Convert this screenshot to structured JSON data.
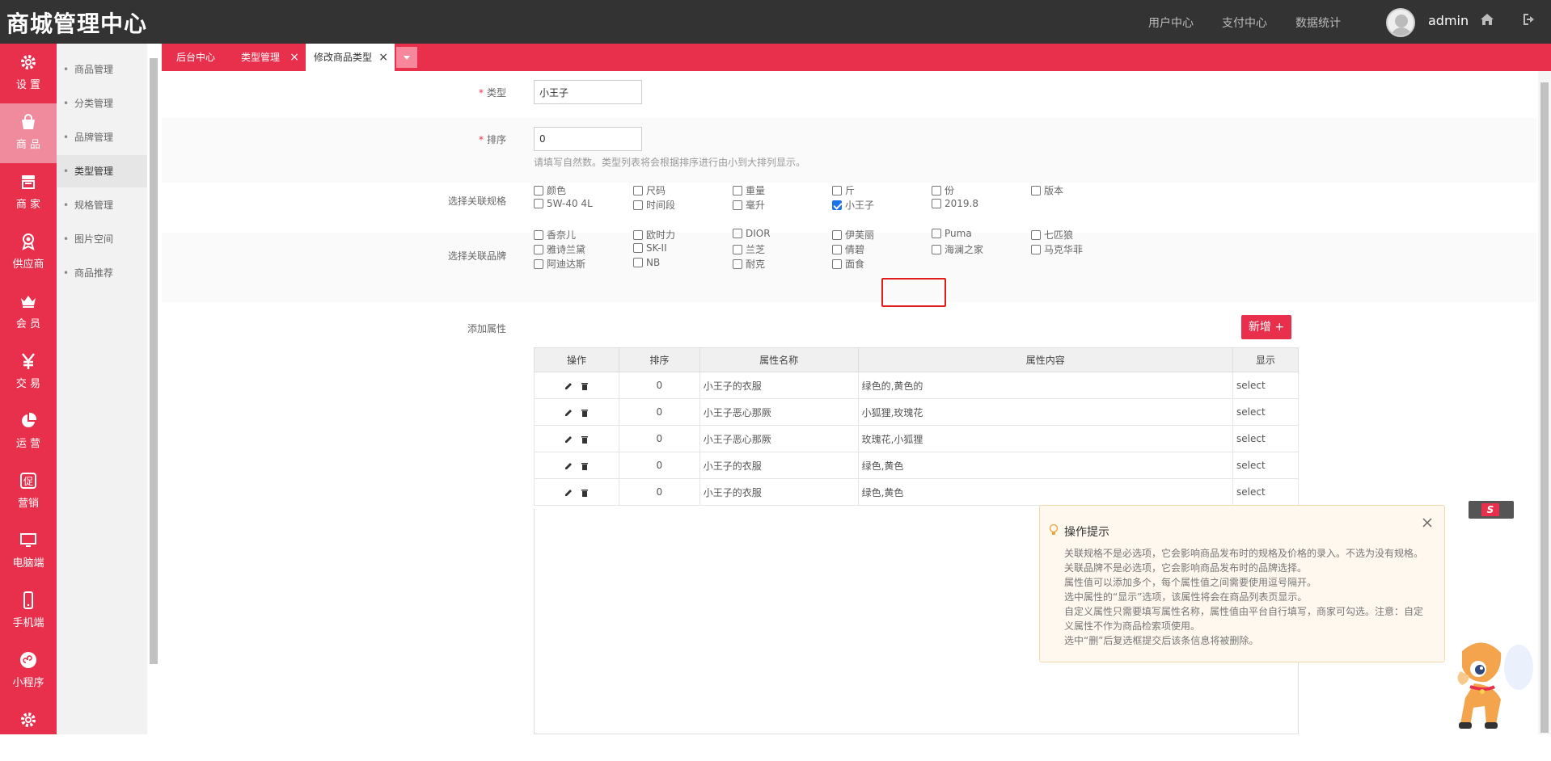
{
  "app": {
    "title": "商城管理中心",
    "top_nav": [
      "用户中心",
      "支付中心",
      "数据统计"
    ],
    "user": "admin"
  },
  "sidebar": [
    {
      "label": "设 置",
      "icon": "gear-icon"
    },
    {
      "label": "商 品",
      "icon": "shopping-bag-icon",
      "active": true
    },
    {
      "label": "商 家",
      "icon": "store-icon"
    },
    {
      "label": "供应商",
      "icon": "award-icon"
    },
    {
      "label": "会 员",
      "icon": "crown-icon"
    },
    {
      "label": "交 易",
      "icon": "yen-icon"
    },
    {
      "label": "运 营",
      "icon": "pie-chart-icon"
    },
    {
      "label": "营销",
      "icon": "promo-icon"
    },
    {
      "label": "电脑端",
      "icon": "monitor-icon"
    },
    {
      "label": "手机端",
      "icon": "mobile-icon"
    },
    {
      "label": "小程序",
      "icon": "miniprogram-icon"
    },
    {
      "label": "",
      "icon": "gear-icon"
    }
  ],
  "submenu": [
    {
      "label": "商品管理"
    },
    {
      "label": "分类管理"
    },
    {
      "label": "品牌管理"
    },
    {
      "label": "类型管理",
      "active": true
    },
    {
      "label": "规格管理"
    },
    {
      "label": "图片空间"
    },
    {
      "label": "商品推荐"
    }
  ],
  "tabs": [
    {
      "label": "后台中心"
    },
    {
      "label": "类型管理",
      "closable": true
    },
    {
      "label": "修改商品类型",
      "closable": true,
      "active": true
    }
  ],
  "form": {
    "type_label": "类型",
    "type_value": "小王子",
    "sort_label": "排序",
    "sort_value": "0",
    "sort_hint": "请填写自然数。类型列表将会根据排序进行由小到大排列显示。",
    "spec_label": "选择关联规格",
    "specs": [
      {
        "label": "颜色",
        "checked": false
      },
      {
        "label": "尺码",
        "checked": false
      },
      {
        "label": "重量",
        "checked": false
      },
      {
        "label": "斤",
        "checked": false
      },
      {
        "label": "份",
        "checked": false
      },
      {
        "label": "版本",
        "checked": false
      },
      {
        "label": "5W-40 4L",
        "checked": false
      },
      {
        "label": "时间段",
        "checked": false
      },
      {
        "label": "毫升",
        "checked": false
      },
      {
        "label": "小王子",
        "checked": true
      },
      {
        "label": "2019.8",
        "checked": false
      }
    ],
    "brand_label": "选择关联品牌",
    "brands": [
      {
        "label": "香奈儿",
        "checked": false
      },
      {
        "label": "欧时力",
        "checked": false
      },
      {
        "label": "DIOR",
        "checked": false
      },
      {
        "label": "伊芙丽",
        "checked": false
      },
      {
        "label": "Puma",
        "checked": false
      },
      {
        "label": "七匹狼",
        "checked": false
      },
      {
        "label": "雅诗兰黛",
        "checked": false
      },
      {
        "label": "SK-II",
        "checked": false
      },
      {
        "label": "兰芝",
        "checked": false
      },
      {
        "label": "倩碧",
        "checked": false
      },
      {
        "label": "海澜之家",
        "checked": false
      },
      {
        "label": "马克华菲",
        "checked": false
      },
      {
        "label": "阿迪达斯",
        "checked": false
      },
      {
        "label": "NB",
        "checked": false
      },
      {
        "label": "耐克",
        "checked": false
      },
      {
        "label": "面食",
        "checked": false
      }
    ],
    "attr_label": "添加属性",
    "add_button": "新增 +"
  },
  "attr_table": {
    "headers": [
      "操作",
      "排序",
      "属性名称",
      "属性内容",
      "显示"
    ],
    "rows": [
      {
        "sort": "0",
        "name": "小王子的衣服",
        "content": "绿色的,黄色的",
        "display": "select"
      },
      {
        "sort": "0",
        "name": "小王子恶心那厥",
        "content": "小狐狸,玫瑰花",
        "display": "select"
      },
      {
        "sort": "0",
        "name": "小王子恶心那厥",
        "content": "玫瑰花,小狐狸",
        "display": "select"
      },
      {
        "sort": "0",
        "name": "小王子的衣服",
        "content": "绿色,黄色",
        "display": "select"
      },
      {
        "sort": "0",
        "name": "小王子的衣服",
        "content": "绿色,黄色",
        "display": "select"
      }
    ]
  },
  "tip": {
    "title": "操作提示",
    "lines": [
      "关联规格不是必选项，它会影响商品发布时的规格及价格的录入。不选为没有规格。",
      "关联品牌不是必选项，它会影响商品发布时的品牌选择。",
      "属性值可以添加多个，每个属性值之间需要使用逗号隔开。",
      "选中属性的“显示”选项，该属性将会在商品列表页显示。",
      "自定义属性只需要填写属性名称，属性值由平台自行填写，商家可勾选。注意：自定义属性不作为商品检索项使用。",
      "选中“删”后复选框提交后该条信息将被删除。"
    ]
  },
  "colors": {
    "brand_red": "#e8304c",
    "topbar": "#333333",
    "checkbox_checked": "#1a73e8"
  }
}
